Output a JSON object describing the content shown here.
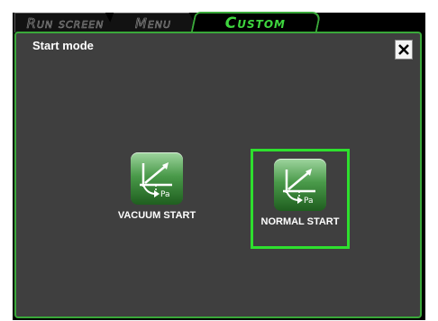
{
  "tabs": [
    {
      "label": "Run screen",
      "active": false
    },
    {
      "label": "Menu",
      "active": false
    },
    {
      "label": "Custom",
      "active": true
    }
  ],
  "panel": {
    "title": "Start mode",
    "close_icon": "close-icon"
  },
  "modes": [
    {
      "label": "VACUUM START",
      "icon": "pressure-graph-icon",
      "icon_text": "Pa",
      "selected": false
    },
    {
      "label": "NORMAL START",
      "icon": "pressure-graph-icon",
      "icon_text": "Pa",
      "selected": true
    }
  ],
  "colors": {
    "accent": "#3aa83a",
    "selected_border": "#2ee02e",
    "panel_bg": "#3f3f3f",
    "background": "#000000"
  }
}
